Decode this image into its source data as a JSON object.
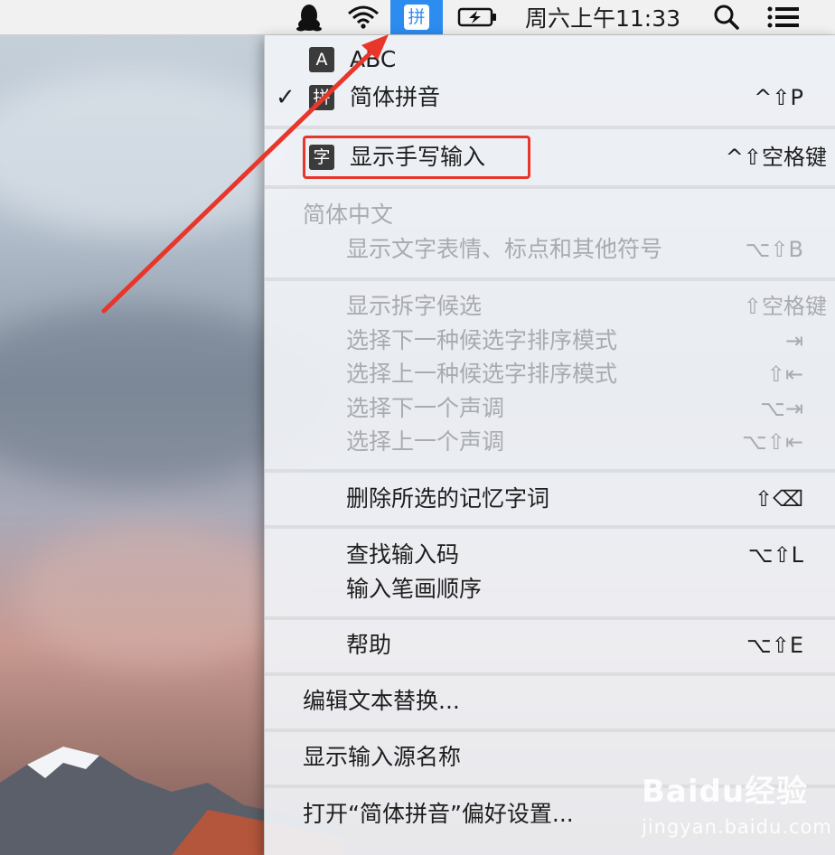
{
  "menubar": {
    "icons": [
      "qq-penguin-icon",
      "wifi-icon",
      "input-method-icon",
      "battery-charging-icon",
      "search-icon",
      "notification-list-icon"
    ],
    "ime_glyph": "拼",
    "clock": "周六上午11:33"
  },
  "menu": {
    "abc": {
      "badge": "A",
      "label": "ABC"
    },
    "pinyin": {
      "check": "✓",
      "badge": "拼",
      "label": "简体拼音",
      "shortcut": "^⇧P"
    },
    "handwriting": {
      "badge": "字",
      "label": "显示手写输入",
      "shortcut": "^⇧空格键"
    },
    "section_header": "简体中文",
    "emoji": {
      "label": "显示文字表情、标点和其他符号",
      "shortcut": "⌥⇧B"
    },
    "group_candidates": [
      {
        "label": "显示拆字候选",
        "shortcut": "⇧空格键"
      },
      {
        "label": "选择下一种候选字排序模式",
        "shortcut": "⇥"
      },
      {
        "label": "选择上一种候选字排序模式",
        "shortcut": "⇧⇤"
      },
      {
        "label": "选择下一个声调",
        "shortcut": "⌥⇥"
      },
      {
        "label": "选择上一个声调",
        "shortcut": "⌥⇧⇤"
      }
    ],
    "delete_memory": {
      "label": "删除所选的记忆字词",
      "shortcut": "⇧⌫"
    },
    "lookup": {
      "label": "查找输入码",
      "shortcut": "⌥⇧L"
    },
    "stroke_order": {
      "label": "输入笔画顺序"
    },
    "help": {
      "label": "帮助",
      "shortcut": "⌥⇧E"
    },
    "edit_replace": "编辑文本替换...",
    "show_source_name": "显示输入源名称",
    "open_prefs": "打开“简体拼音”偏好设置..."
  },
  "colors": {
    "highlight_box": "#e8362b",
    "arrow": "#e8362b",
    "ime_active": "#2d8cf0"
  },
  "watermark": {
    "main": "Baidu经验",
    "sub": "jingyan.baidu.com"
  }
}
